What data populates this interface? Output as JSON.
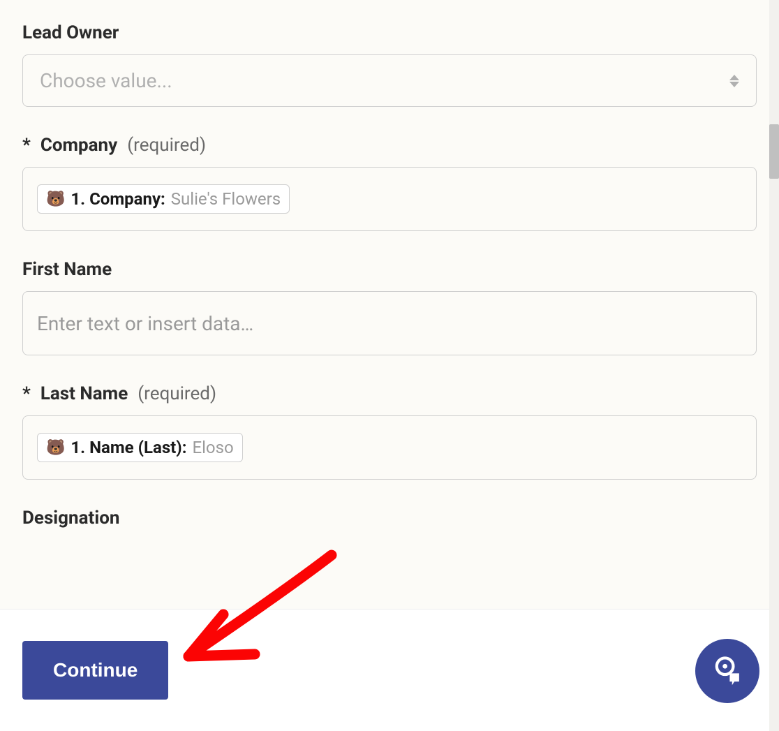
{
  "fields": {
    "leadOwner": {
      "label": "Lead Owner",
      "placeholder": "Choose value..."
    },
    "company": {
      "asterisk": "*",
      "label": "Company",
      "requiredText": "(required)",
      "pill": {
        "icon": "🐻",
        "key": "1. Company:",
        "value": "Sulie's Flowers"
      }
    },
    "firstName": {
      "label": "First Name",
      "placeholder": "Enter text or insert data…"
    },
    "lastName": {
      "asterisk": "*",
      "label": "Last Name",
      "requiredText": "(required)",
      "pill": {
        "icon": "🐻",
        "key": "1. Name (Last):",
        "value": "Eloso"
      }
    },
    "designation": {
      "label": "Designation"
    }
  },
  "footer": {
    "continueLabel": "Continue"
  },
  "colors": {
    "primary": "#3b499a",
    "annotation": "#fb0404"
  }
}
